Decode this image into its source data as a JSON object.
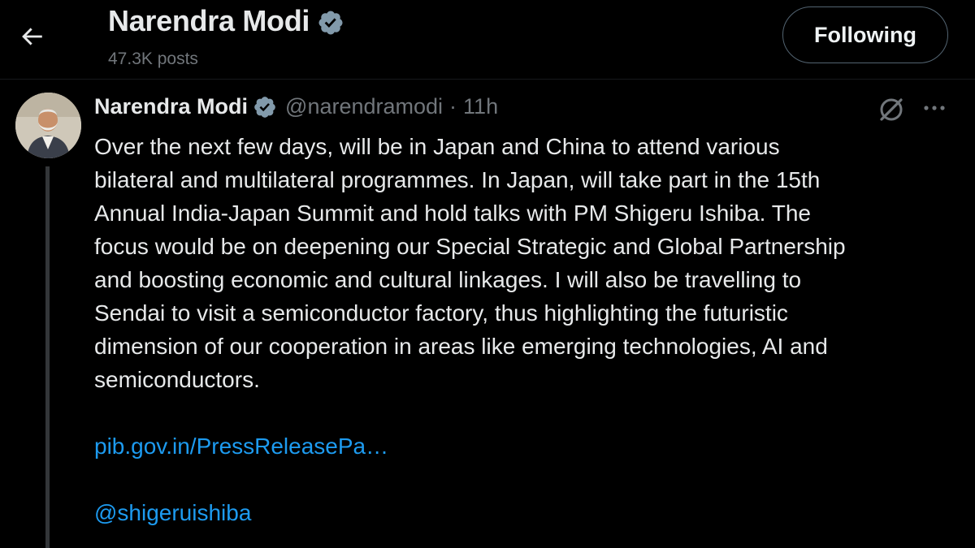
{
  "header": {
    "name": "Narendra Modi",
    "posts_count": "47.3K posts",
    "follow_label": "Following",
    "back_icon": "arrow-left-icon",
    "verified_icon": "verified-badge-icon"
  },
  "tweet": {
    "author_name": "Narendra Modi",
    "handle": "@narendramodi",
    "separator": "·",
    "time": "11h",
    "text": "Over the next few days, will be in Japan and China to attend various\nbilateral and multilateral programmes. In Japan, will take part in the 15th\nAnnual India-Japan Summit and hold talks with PM Shigeru Ishiba. The\nfocus would be on deepening our Special Strategic and Global Partnership\nand boosting economic and cultural linkages. I will also be travelling to\nSendai to visit a semiconductor factory, thus highlighting the futuristic\ndimension of our cooperation in areas like emerging technologies, AI and\nsemiconductors.",
    "link": "pib.gov.in/PressReleasePa…",
    "mention": "@shigeruishiba",
    "grok_icon": "grok-icon",
    "more_icon": "more-horizontal-icon"
  },
  "colors": {
    "background": "#000000",
    "text": "#e7e9ea",
    "muted": "#71767b",
    "link": "#1d9bf0",
    "verified": "#829aab"
  }
}
